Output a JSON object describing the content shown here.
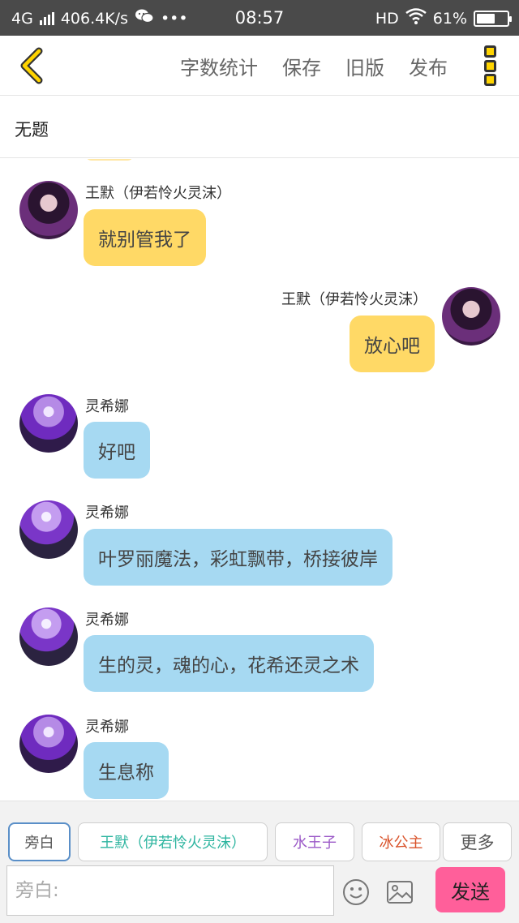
{
  "status_bar": {
    "network": "4G",
    "speed": "406.4K/s",
    "wechat_icon": "wechat-icon",
    "dots": "•••",
    "time": "08:57",
    "hd": "HD",
    "battery": "61%",
    "battery_level": 0.61
  },
  "toolbar": {
    "back_icon": "chevron-left-icon",
    "actions": [
      "字数统计",
      "保存",
      "旧版",
      "发布"
    ],
    "more_icon": "more-vertical-icon",
    "accent": "#ffd400"
  },
  "document": {
    "title": "无题"
  },
  "messages": [
    {
      "side": "left",
      "sender": "王默（伊若怜火灵沫）",
      "text": "就别管我了",
      "color": "yellow"
    },
    {
      "side": "right",
      "sender": "王默（伊若怜火灵沫）",
      "text": "放心吧",
      "color": "yellow"
    },
    {
      "side": "left",
      "sender": "灵希娜",
      "text": "好吧",
      "color": "blue"
    },
    {
      "side": "left",
      "sender": "灵希娜",
      "text": "叶罗丽魔法，彩虹飘带，桥接彼岸",
      "color": "blue"
    },
    {
      "side": "left",
      "sender": "灵希娜",
      "text": "生的灵，魂的心，花希还灵之术",
      "color": "blue"
    },
    {
      "side": "left",
      "sender": "灵希娜",
      "text": "生息称",
      "color": "blue"
    }
  ],
  "characters": [
    {
      "label": "旁白",
      "color": "#555555",
      "active": true
    },
    {
      "label": "王默（伊若怜火灵沫）",
      "color": "#2eb5a0",
      "active": false
    },
    {
      "label": "水王子",
      "color": "#9b59c7",
      "active": false
    },
    {
      "label": "冰公主",
      "color": "#d9532b",
      "active": false
    },
    {
      "label": "更多",
      "color": "#555555",
      "active": false
    }
  ],
  "input": {
    "placeholder": "旁白:",
    "emoji_icon": "smiley-icon",
    "image_icon": "image-icon",
    "send_label": "发送",
    "send_color": "#ff5f9a"
  }
}
